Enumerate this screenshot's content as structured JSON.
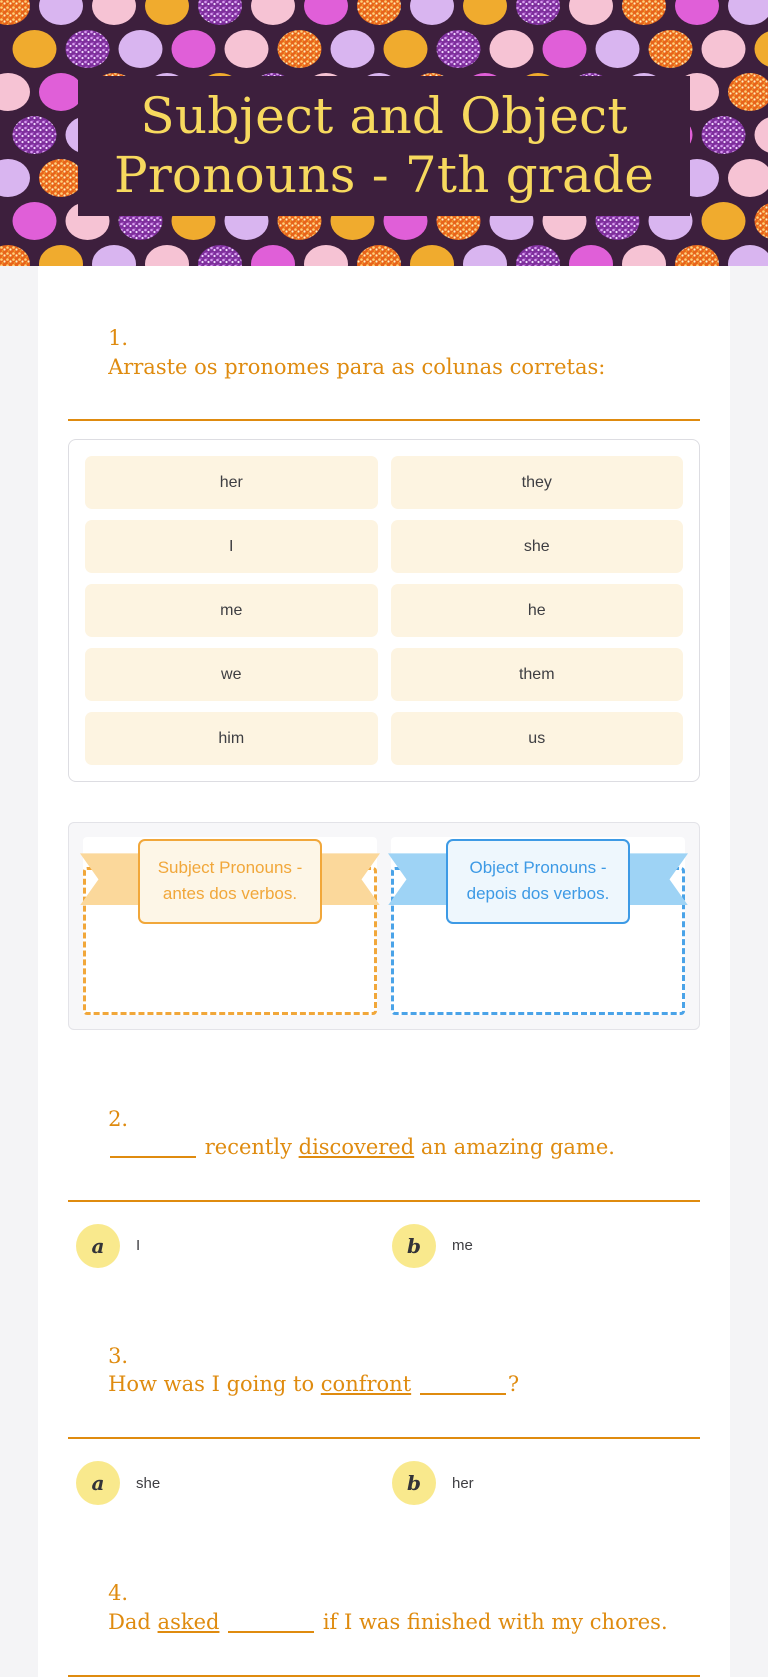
{
  "header": {
    "title": "Subject and Object Pronouns - 7th grade",
    "background_color": "#3d1f3d",
    "title_color": "#f7d95e",
    "dot_colors": [
      "#f0ab2e",
      "#e05fd8",
      "#d9b5f0",
      "#f6c3d4",
      "#e8641a",
      "#8e3aa8"
    ]
  },
  "theme": {
    "accent_orange": "#df8b0f",
    "tile_bg": "#fdf4e1",
    "badge_bg": "#f9e98d",
    "blue": "#3d9ae5",
    "page_bg": "#f4f4f6"
  },
  "questions": [
    {
      "number": "1.",
      "prompt": "Arraste os pronomes para as colunas corretas:",
      "type": "drag-and-drop",
      "tiles": [
        "her",
        "they",
        "I",
        "she",
        "me",
        "he",
        "we",
        "them",
        "him",
        "us"
      ],
      "dropzones": [
        {
          "label": "Subject Pronouns - antes dos verbos.",
          "color": "orange"
        },
        {
          "label": "Object Pronouns - depois dos verbos.",
          "color": "blue"
        }
      ]
    },
    {
      "number": "2.",
      "type": "multiple-choice",
      "sentence_parts": [
        {
          "text": "",
          "style": "plain"
        },
        {
          "text": "",
          "style": "blank"
        },
        {
          "text": " recently ",
          "style": "plain"
        },
        {
          "text": "discovered",
          "style": "underline"
        },
        {
          "text": " an amazing game.",
          "style": "plain"
        }
      ],
      "options": [
        {
          "letter": "a",
          "text": "I"
        },
        {
          "letter": "b",
          "text": "me"
        }
      ]
    },
    {
      "number": "3.",
      "type": "multiple-choice",
      "sentence_parts": [
        {
          "text": "How was I going to ",
          "style": "plain"
        },
        {
          "text": "confront",
          "style": "underline"
        },
        {
          "text": " ",
          "style": "plain"
        },
        {
          "text": "",
          "style": "blank"
        },
        {
          "text": "?",
          "style": "plain"
        }
      ],
      "options": [
        {
          "letter": "a",
          "text": "she"
        },
        {
          "letter": "b",
          "text": "her"
        }
      ]
    },
    {
      "number": "4.",
      "type": "multiple-choice",
      "sentence_parts": [
        {
          "text": "Dad ",
          "style": "plain"
        },
        {
          "text": "asked",
          "style": "underline"
        },
        {
          "text": " ",
          "style": "plain"
        },
        {
          "text": "",
          "style": "blank"
        },
        {
          "text": " if I was finished with my chores.",
          "style": "plain"
        }
      ],
      "options": []
    }
  ]
}
